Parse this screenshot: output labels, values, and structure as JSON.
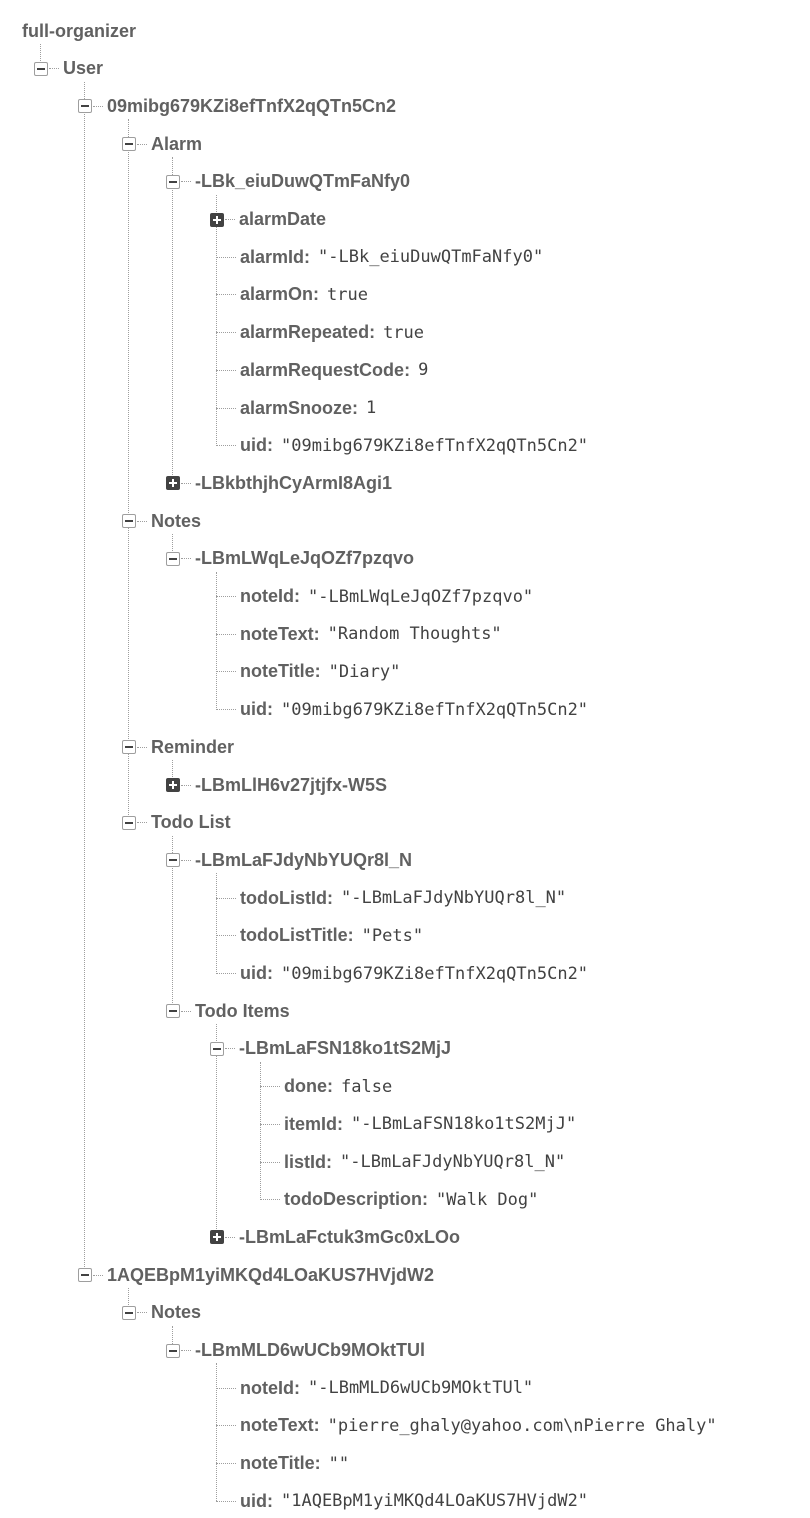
{
  "root": {
    "label": "full-organizer",
    "children": [
      {
        "key": "User",
        "expanded": true,
        "children": [
          {
            "key": "09mibg679KZi8efTnfX2qQTn5Cn2",
            "expanded": true,
            "children": [
              {
                "key": "Alarm",
                "expanded": true,
                "children": [
                  {
                    "key": "-LBk_eiuDuwQTmFaNfy0",
                    "expanded": true,
                    "children": [
                      {
                        "key": "alarmDate",
                        "expanded": false
                      },
                      {
                        "key": "alarmId",
                        "value": "\"-LBk_eiuDuwQTmFaNfy0\""
                      },
                      {
                        "key": "alarmOn",
                        "value": "true"
                      },
                      {
                        "key": "alarmRepeated",
                        "value": "true"
                      },
                      {
                        "key": "alarmRequestCode",
                        "value": "9"
                      },
                      {
                        "key": "alarmSnooze",
                        "value": "1"
                      },
                      {
                        "key": "uid",
                        "value": "\"09mibg679KZi8efTnfX2qQTn5Cn2\""
                      }
                    ]
                  },
                  {
                    "key": "-LBkbthjhCyArmI8Agi1",
                    "expanded": false
                  }
                ]
              },
              {
                "key": "Notes",
                "expanded": true,
                "children": [
                  {
                    "key": "-LBmLWqLeJqOZf7pzqvo",
                    "expanded": true,
                    "children": [
                      {
                        "key": "noteId",
                        "value": "\"-LBmLWqLeJqOZf7pzqvo\""
                      },
                      {
                        "key": "noteText",
                        "value": "\"Random Thoughts\""
                      },
                      {
                        "key": "noteTitle",
                        "value": "\"Diary\""
                      },
                      {
                        "key": "uid",
                        "value": "\"09mibg679KZi8efTnfX2qQTn5Cn2\""
                      }
                    ]
                  }
                ]
              },
              {
                "key": "Reminder",
                "expanded": true,
                "children": [
                  {
                    "key": "-LBmLlH6v27jtjfx-W5S",
                    "expanded": false
                  }
                ]
              },
              {
                "key": "Todo List",
                "expanded": true,
                "children": [
                  {
                    "key": "-LBmLaFJdyNbYUQr8l_N",
                    "expanded": true,
                    "children": [
                      {
                        "key": "todoListId",
                        "value": "\"-LBmLaFJdyNbYUQr8l_N\""
                      },
                      {
                        "key": "todoListTitle",
                        "value": "\"Pets\""
                      },
                      {
                        "key": "uid",
                        "value": "\"09mibg679KZi8efTnfX2qQTn5Cn2\""
                      }
                    ]
                  },
                  {
                    "key": "Todo Items",
                    "expanded": true,
                    "children": [
                      {
                        "key": "-LBmLaFSN18ko1tS2MjJ",
                        "expanded": true,
                        "children": [
                          {
                            "key": "done",
                            "value": "false"
                          },
                          {
                            "key": "itemId",
                            "value": "\"-LBmLaFSN18ko1tS2MjJ\""
                          },
                          {
                            "key": "listId",
                            "value": "\"-LBmLaFJdyNbYUQr8l_N\""
                          },
                          {
                            "key": "todoDescription",
                            "value": "\"Walk Dog\""
                          }
                        ]
                      },
                      {
                        "key": "-LBmLaFctuk3mGc0xLOo",
                        "expanded": false
                      }
                    ]
                  }
                ]
              }
            ]
          },
          {
            "key": "1AQEBpM1yiMKQd4LOaKUS7HVjdW2",
            "expanded": true,
            "children": [
              {
                "key": "Notes",
                "expanded": true,
                "children": [
                  {
                    "key": "-LBmMLD6wUCb9MOktTUl",
                    "expanded": true,
                    "children": [
                      {
                        "key": "noteId",
                        "value": "\"-LBmMLD6wUCb9MOktTUl\""
                      },
                      {
                        "key": "noteText",
                        "value": "\"pierre_ghaly@yahoo.com\\nPierre Ghaly\""
                      },
                      {
                        "key": "noteTitle",
                        "value": "\"\""
                      },
                      {
                        "key": "uid",
                        "value": "\"1AQEBpM1yiMKQd4LOaKUS7HVjdW2\""
                      }
                    ]
                  }
                ]
              }
            ]
          }
        ]
      }
    ]
  }
}
